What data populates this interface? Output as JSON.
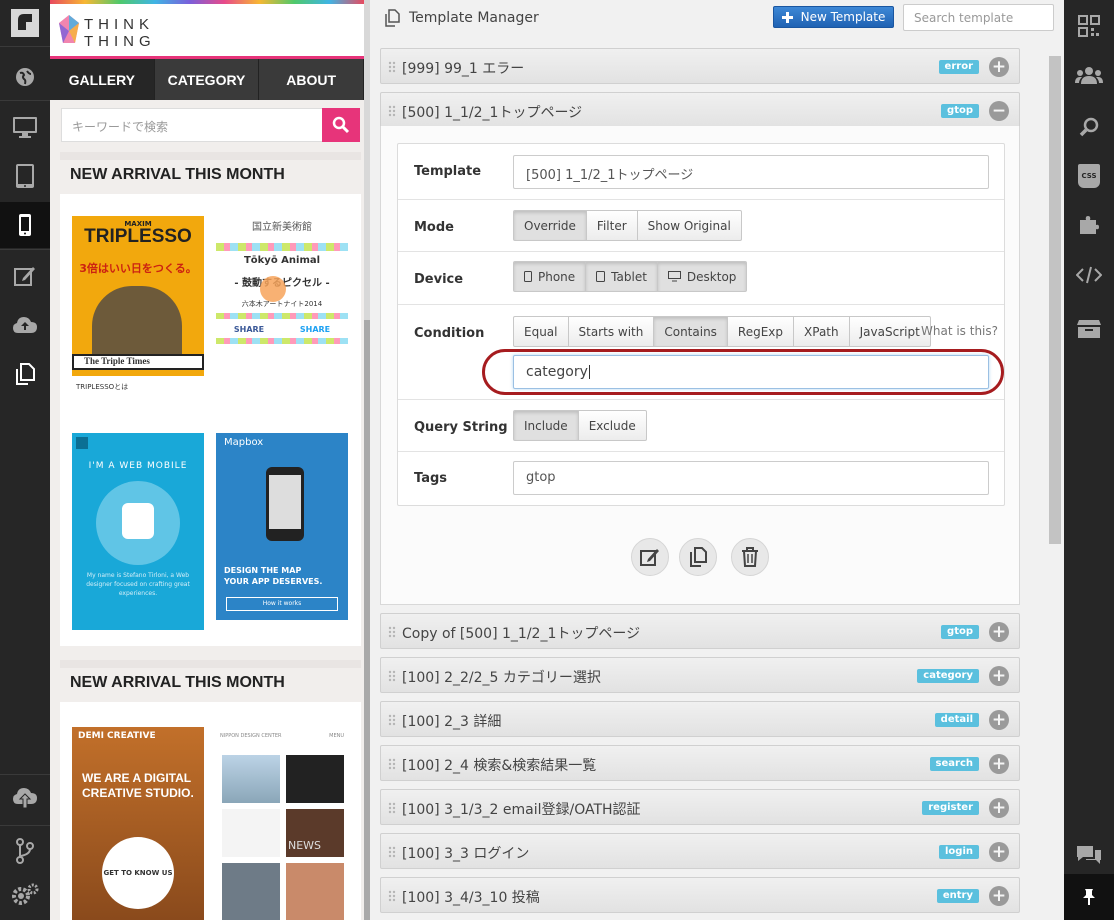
{
  "header": {
    "title": "Template Manager",
    "new_template_label": "New Template",
    "search_placeholder": "Search template"
  },
  "preview": {
    "logo_line1": "THINK",
    "logo_line2": "THING",
    "nav": [
      "GALLERY",
      "CATEGORY",
      "ABOUT"
    ],
    "search_placeholder": "キーワードで検索",
    "section_title_1": "NEW ARRIVAL THIS MONTH",
    "section_title_2": "NEW ARRIVAL THIS MONTH",
    "thumb1": {
      "top": "MAXIM",
      "title": "TRIPLESSO",
      "jp": "3倍はいい日をつくる。",
      "banner": "The Triple Times",
      "footer": "TRIPLESSOとは"
    },
    "thumb2": {
      "top": "国立新美術館",
      "title": "Tōkyō Animal",
      "sub": "- 鼓動するピクセル -",
      "date": "六本木アートナイト2014",
      "share1": "SHARE",
      "share2": "SHARE"
    },
    "thumb3": {
      "title": "I'M A WEB MOBILE",
      "text": "My name is Stefano Tirloni, a Web designer focused on crafting great experiences."
    },
    "thumb4": {
      "title": "Mapbox",
      "tag1": "DESIGN THE MAP",
      "tag2": "YOUR APP DESERVES.",
      "btn": "How it works"
    },
    "thumb5": {
      "title": "DEMI CREATIVE",
      "hero": "WE ARE A DIGITAL CREATIVE STUDIO.",
      "btn": "GET TO KNOW US"
    },
    "thumb6": {
      "title": "NIPPON DESIGN CENTER",
      "menu": "MENU",
      "news": "NEWS"
    }
  },
  "templates_top": [
    {
      "label": "[999] 99_1 エラー",
      "tag": "error",
      "state": "+"
    },
    {
      "label": "[500] 1_1/2_1トップページ",
      "tag": "gtop",
      "state": "−"
    }
  ],
  "form": {
    "template_label": "Template",
    "template_value": "[500] 1_1/2_1トップページ",
    "mode_label": "Mode",
    "mode_options": [
      "Override",
      "Filter",
      "Show Original"
    ],
    "device_label": "Device",
    "device_options": [
      "Phone",
      "Tablet",
      "Desktop"
    ],
    "condition_label": "Condition",
    "condition_options": [
      "Equal",
      "Starts with",
      "Contains",
      "RegExp",
      "XPath",
      "JavaScript"
    ],
    "condition_help": "What is this?",
    "condition_value": "category",
    "query_label": "Query String",
    "query_options": [
      "Include",
      "Exclude"
    ],
    "tags_label": "Tags",
    "tags_value": "gtop"
  },
  "templates_bottom": [
    {
      "label": "Copy of [500] 1_1/2_1トップページ",
      "tag": "gtop",
      "state": "+"
    },
    {
      "label": "[100] 2_2/2_5 カテゴリー選択",
      "tag": "category",
      "state": "+"
    },
    {
      "label": "[100] 2_3 詳細",
      "tag": "detail",
      "state": "+"
    },
    {
      "label": "[100] 2_4 検索&検索結果一覧",
      "tag": "search",
      "state": "+"
    },
    {
      "label": "[100] 3_1/3_2 email登録/OATH認証",
      "tag": "register",
      "state": "+"
    },
    {
      "label": "[100] 3_3 ログイン",
      "tag": "login",
      "state": "+"
    },
    {
      "label": "[100] 3_4/3_10 投稿",
      "tag": "entry",
      "state": "+"
    }
  ],
  "rails": {
    "right_css_label": "CSS"
  }
}
